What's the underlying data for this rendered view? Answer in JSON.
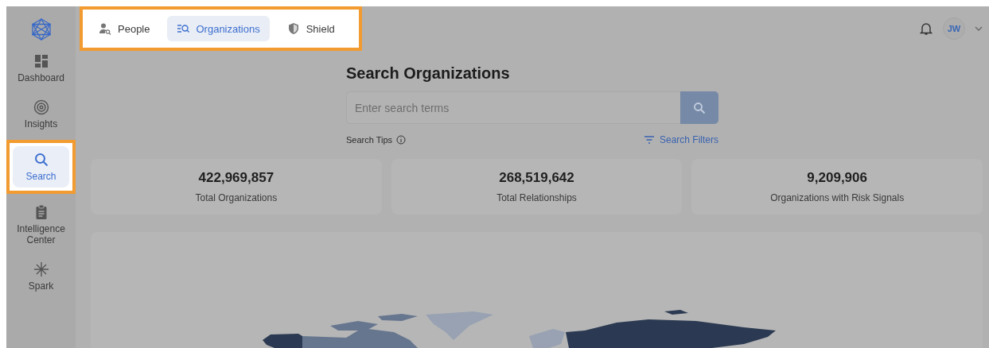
{
  "top_tabs": {
    "highlighted": true,
    "items": [
      {
        "label": "People",
        "selected": false
      },
      {
        "label": "Organizations",
        "selected": true
      },
      {
        "label": "Shield",
        "selected": false
      }
    ]
  },
  "user": {
    "initials": "JW"
  },
  "sidebar": {
    "items": [
      {
        "label": "Dashboard",
        "selected": false,
        "highlighted": false
      },
      {
        "label": "Insights",
        "selected": false,
        "highlighted": false
      },
      {
        "label": "Search",
        "selected": true,
        "highlighted": true
      },
      {
        "label": "Intelligence Center",
        "selected": false,
        "highlighted": false
      },
      {
        "label": "Spark",
        "selected": false,
        "highlighted": false
      }
    ]
  },
  "search": {
    "title": "Search Organizations",
    "placeholder": "Enter search terms",
    "tips": "Search Tips",
    "filters": "Search Filters"
  },
  "stats": [
    {
      "value": "422,969,857",
      "label": "Total Organizations"
    },
    {
      "value": "268,519,642",
      "label": "Total Relationships"
    },
    {
      "value": "9,209,906",
      "label": "Organizations with Risk Signals"
    }
  ]
}
